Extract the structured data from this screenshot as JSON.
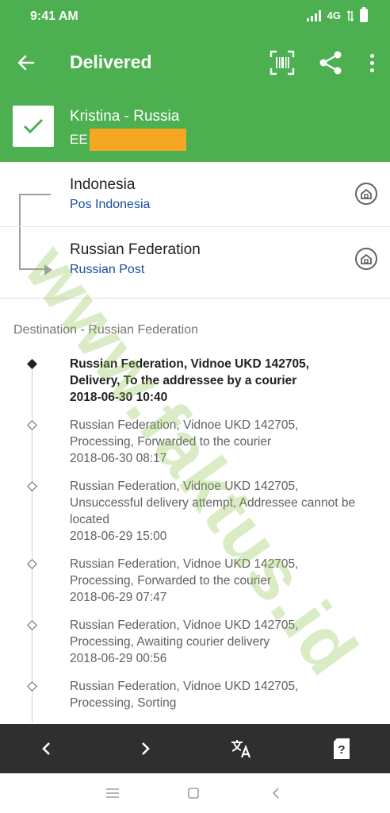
{
  "status_bar": {
    "time": "9:41 AM",
    "network": "4G"
  },
  "app_bar": {
    "title": "Delivered"
  },
  "parcel": {
    "name": "Kristina - Russia",
    "code_prefix": "EE"
  },
  "route": [
    {
      "country": "Indonesia",
      "service": "Pos Indonesia"
    },
    {
      "country": "Russian Federation",
      "service": "Russian Post"
    }
  ],
  "events_section": {
    "title": "Destination - Russian Federation"
  },
  "events": [
    {
      "text": "Russian Federation, Vidnoe UKD 142705, Delivery, To the addressee by a courier",
      "datetime": "2018-06-30 10:40"
    },
    {
      "text": "Russian Federation, Vidnoe UKD 142705, Processing, Forwarded to the courier",
      "datetime": "2018-06-30 08:17"
    },
    {
      "text": "Russian Federation, Vidnoe UKD 142705, Unsuccessful delivery attempt, Addressee cannot be located",
      "datetime": "2018-06-29 15:00"
    },
    {
      "text": "Russian Federation, Vidnoe UKD 142705, Processing, Forwarded to the courier",
      "datetime": "2018-06-29 07:47"
    },
    {
      "text": "Russian Federation, Vidnoe UKD 142705, Processing, Awaiting courier delivery",
      "datetime": "2018-06-29 00:56"
    },
    {
      "text": "Russian Federation, Vidnoe UKD 142705, Processing, Sorting",
      "datetime": ""
    }
  ],
  "watermark": {
    "text": "www.faktus.id"
  },
  "icons": {
    "back": "arrow-left-icon",
    "barcode": "barcode-scan-icon",
    "share": "share-icon",
    "more": "more-vert-icon",
    "check": "check-icon",
    "home": "home-icon",
    "prev": "chevron-left-icon",
    "next": "chevron-right-icon",
    "translate": "translate-icon",
    "help": "help-card-icon"
  },
  "colors": {
    "primary": "#4caf50",
    "link": "#1a4fa0",
    "redaction": "#f5a623",
    "toolbar": "#2f2f2f"
  }
}
